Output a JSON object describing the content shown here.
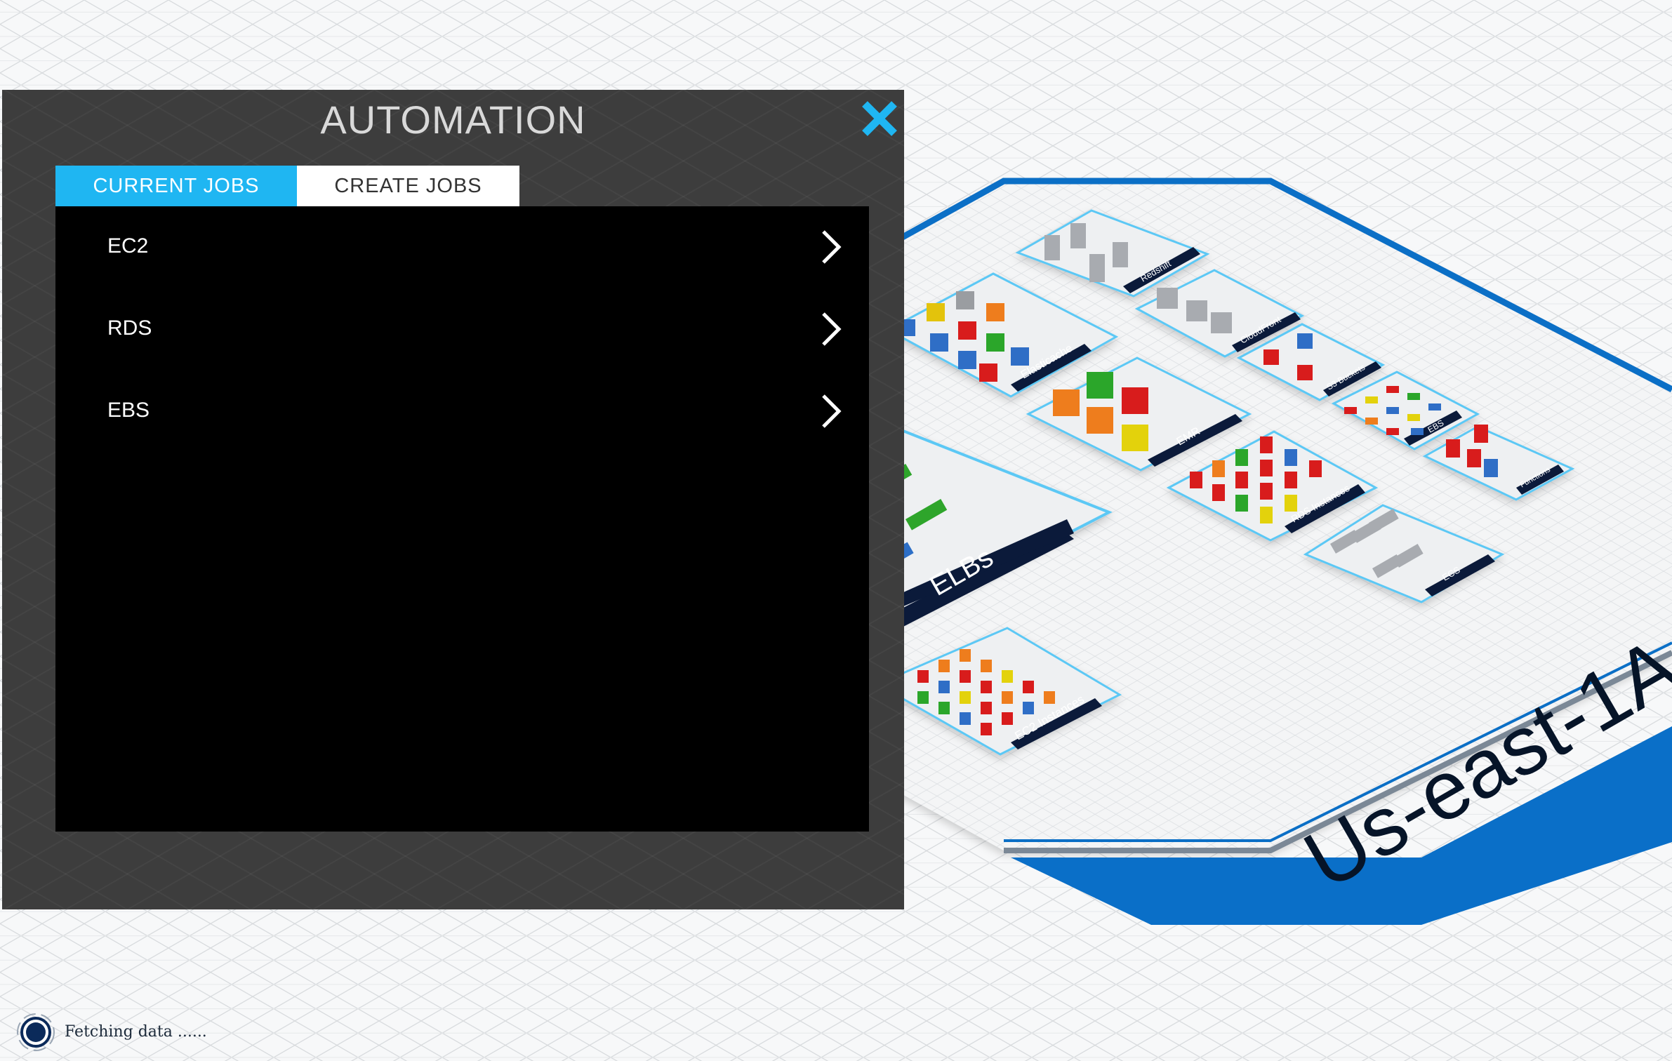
{
  "map": {
    "region_label": "Us-east-1A",
    "groups": {
      "elbs": "ELBs",
      "elasticache": "Elasticache",
      "emr": "EMR",
      "redshift": "Redshift",
      "cloudfront": "CloudFront",
      "s3": "S3 Buckets",
      "ebs": "EBS",
      "functions": "Functions",
      "rds": "RDS Instances",
      "ecs": "ECS",
      "ec2": "EC2 Instances"
    }
  },
  "panel": {
    "title": "AUTOMATION",
    "close_icon": "close-icon",
    "tabs": [
      {
        "label": "CURRENT JOBS",
        "active": true
      },
      {
        "label": "CREATE JOBS",
        "active": false
      }
    ],
    "jobs": [
      {
        "label": "EC2"
      },
      {
        "label": "RDS"
      },
      {
        "label": "EBS"
      }
    ]
  },
  "status": {
    "text": "Fetching data ......",
    "icon": "loading-spinner-icon"
  },
  "colors": {
    "accent": "#1fb6f2",
    "region_blue": "#0b6fc6",
    "panel_bg": "#3d3d3d",
    "label_dark": "#0b1a3a"
  }
}
